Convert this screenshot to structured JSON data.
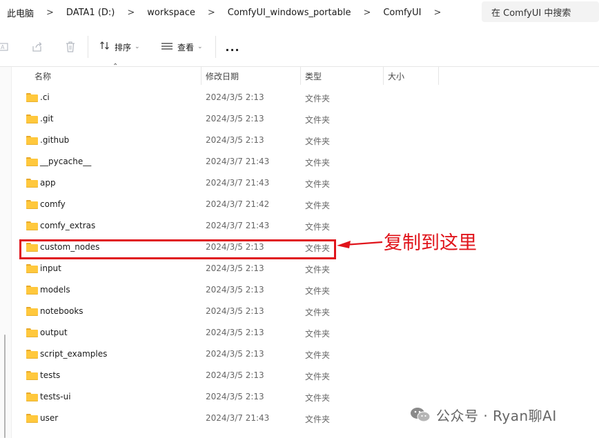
{
  "breadcrumb": {
    "items": [
      "此电脑",
      "DATA1 (D:)",
      "workspace",
      "ComfyUI_windows_portable",
      "ComfyUI"
    ],
    "separator": ">"
  },
  "search": {
    "placeholder": "在 ComfyUI 中搜索"
  },
  "toolbar": {
    "sort_label": "排序",
    "view_label": "查看",
    "more_label": "..."
  },
  "columns": {
    "name": "名称",
    "modified": "修改日期",
    "type": "类型",
    "size": "大小"
  },
  "rows": [
    {
      "name": ".ci",
      "date": "2024/3/5 2:13",
      "type": "文件夹"
    },
    {
      "name": ".git",
      "date": "2024/3/5 2:13",
      "type": "文件夹"
    },
    {
      "name": ".github",
      "date": "2024/3/5 2:13",
      "type": "文件夹"
    },
    {
      "name": "__pycache__",
      "date": "2024/3/7 21:43",
      "type": "文件夹"
    },
    {
      "name": "app",
      "date": "2024/3/7 21:43",
      "type": "文件夹"
    },
    {
      "name": "comfy",
      "date": "2024/3/7 21:42",
      "type": "文件夹"
    },
    {
      "name": "comfy_extras",
      "date": "2024/3/7 21:43",
      "type": "文件夹"
    },
    {
      "name": "custom_nodes",
      "date": "2024/3/5 2:13",
      "type": "文件夹"
    },
    {
      "name": "input",
      "date": "2024/3/5 2:13",
      "type": "文件夹"
    },
    {
      "name": "models",
      "date": "2024/3/5 2:13",
      "type": "文件夹"
    },
    {
      "name": "notebooks",
      "date": "2024/3/5 2:13",
      "type": "文件夹"
    },
    {
      "name": "output",
      "date": "2024/3/5 2:13",
      "type": "文件夹"
    },
    {
      "name": "script_examples",
      "date": "2024/3/5 2:13",
      "type": "文件夹"
    },
    {
      "name": "tests",
      "date": "2024/3/5 2:13",
      "type": "文件夹"
    },
    {
      "name": "tests-ui",
      "date": "2024/3/5 2:13",
      "type": "文件夹"
    },
    {
      "name": "user",
      "date": "2024/3/7 21:43",
      "type": "文件夹"
    }
  ],
  "annotation": {
    "text": "复制到这里",
    "color": "#e0141b"
  },
  "watermark": {
    "text": "公众号 · Ryan聊AI"
  },
  "colors": {
    "folder": "#ffc83d",
    "folder_tab": "#e8a92a",
    "highlight": "#e0141b"
  },
  "icons": [
    "rename-icon",
    "share-icon",
    "delete-icon",
    "sort-icon",
    "view-icon",
    "more-icon",
    "folder-icon",
    "wechat-logo-icon"
  ]
}
